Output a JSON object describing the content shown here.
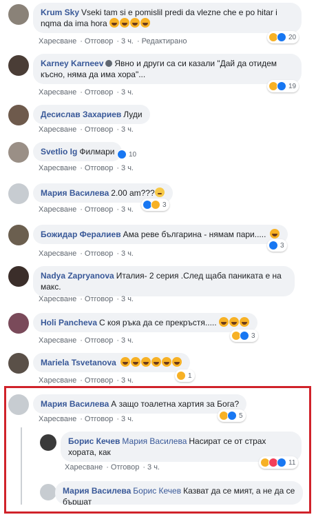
{
  "comments": [
    {
      "author": "Krum Sky",
      "text": "Vseki tam si e pomislil predi da vlezne che e po hitar i nqma da ima hora",
      "emoji_count": 4,
      "actions": {
        "like": "Харесване",
        "reply": "Отговор",
        "time": "3 ч.",
        "extra": "Редактирано"
      },
      "reactions": "20"
    },
    {
      "author": "Karney Karneev",
      "text": "Явно и други са си казали \"Дай да отидем късно, няма да има хора\"...",
      "actions": {
        "like": "Харесване",
        "reply": "Отговор",
        "time": "3 ч."
      },
      "reactions": "19"
    },
    {
      "author": "Десислав Захариев",
      "text": "Луди",
      "actions": {
        "like": "Харесване",
        "reply": "Отговор",
        "time": "3 ч."
      }
    },
    {
      "author": "Svetlio Ig",
      "text": "Филмари",
      "actions": {
        "like": "Харесване",
        "reply": "Отговор",
        "time": "3 ч."
      },
      "reactions": "10"
    },
    {
      "author": "Мария Василева",
      "text": "2.00 am???",
      "actions": {
        "like": "Харесване",
        "reply": "Отговор",
        "time": "3 ч."
      },
      "reactions": "3"
    },
    {
      "author": "Божидар Фералиев",
      "text": "Ама реве българина - нямам пари.....",
      "actions": {
        "like": "Харесване",
        "reply": "Отговор",
        "time": "3 ч."
      },
      "reactions": "3"
    },
    {
      "author": "Nadya Zapryanova",
      "text": "Италия- 2 серия .След щаба паниката е на макс.",
      "actions": {
        "like": "Харесване",
        "reply": "Отговор",
        "time": "3 ч."
      }
    },
    {
      "author": "Holi Pancheva",
      "text": "С коя ръка да се прекръстя.....",
      "actions": {
        "like": "Харесване",
        "reply": "Отговор",
        "time": "3 ч."
      },
      "reactions": "3"
    },
    {
      "author": "Mariela Tsvetanova",
      "text": "",
      "actions": {
        "like": "Харесване",
        "reply": "Отговор",
        "time": "3 ч."
      },
      "reactions": "1"
    },
    {
      "author": "Мария Василева",
      "text": "А защо тоалетна хартия за Бога?",
      "actions": {
        "like": "Харесване",
        "reply": "Отговор",
        "time": "3 ч."
      },
      "reactions": "5"
    }
  ],
  "replies": [
    {
      "author": "Борис Кечев",
      "mention": "Мария Василева",
      "text": "Насират се от страх хората, как",
      "actions": {
        "like": "Харесване",
        "reply": "Отговор",
        "time": "3 ч."
      },
      "reactions": "11"
    },
    {
      "author": "Мария Василева",
      "mention": "Борис Кечев",
      "text": "Казват да се мият, а не да се бършат"
    }
  ],
  "colors": {
    "accent": "#385898",
    "highlight": "#d0222a",
    "bubble": "#f0f2f5",
    "like": "#1877f2",
    "haha": "#f7b125",
    "love": "#f33e58"
  },
  "icons": [
    "like-reaction-icon",
    "haha-reaction-icon",
    "love-reaction-icon",
    "wow-reaction-icon",
    "verified-badge-icon"
  ]
}
